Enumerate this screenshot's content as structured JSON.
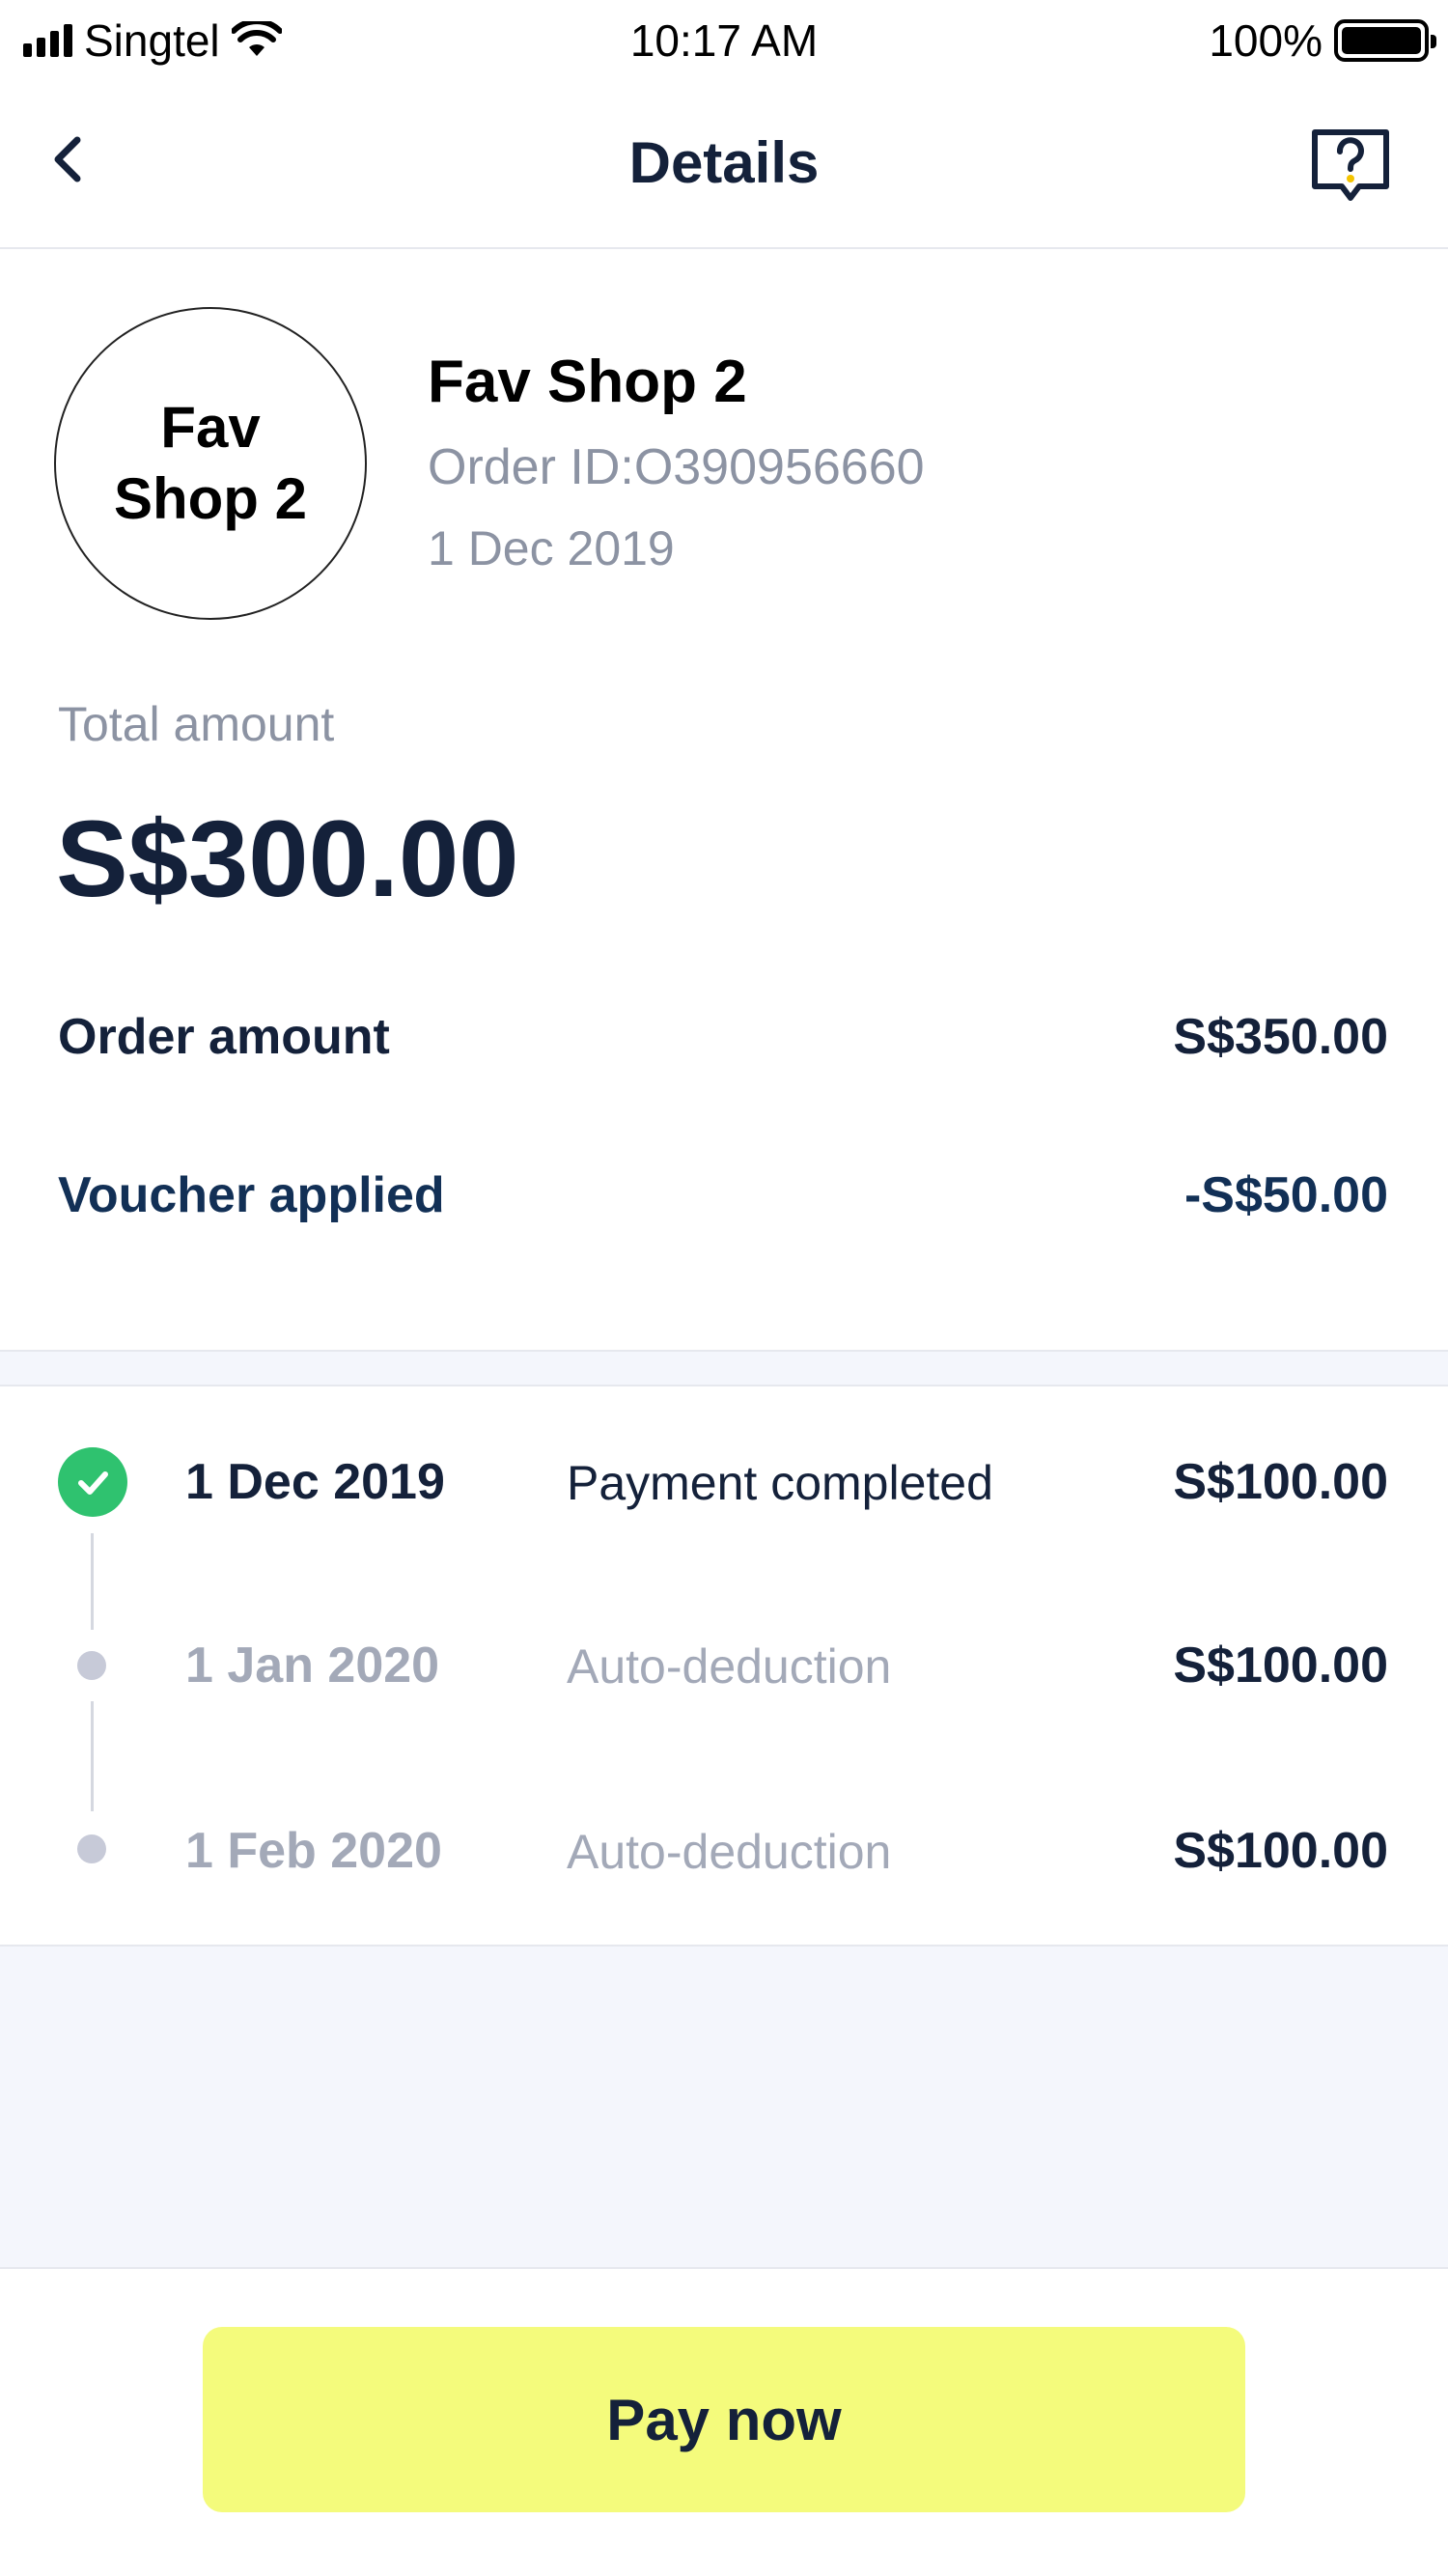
{
  "status_bar": {
    "carrier": "Singtel",
    "time": "10:17 AM",
    "battery": "100%"
  },
  "nav": {
    "title": "Details",
    "back_icon": "chevron-left-icon",
    "help_icon": "help-chat-icon"
  },
  "merchant": {
    "logo_text": "Fav Shop 2",
    "name": "Fav Shop 2",
    "order_id": "Order ID:O390956660",
    "date": "1 Dec 2019"
  },
  "summary": {
    "total_label": "Total amount",
    "total_amount": "S$300.00",
    "order_amount_label": "Order amount",
    "order_amount_value": "S$350.00",
    "voucher_label": "Voucher applied",
    "voucher_value": "-S$50.00"
  },
  "payments": [
    {
      "date": "1 Dec 2019",
      "description": "Payment completed",
      "amount": "S$100.00",
      "status": "completed"
    },
    {
      "date": "1 Jan 2020",
      "description": "Auto-deduction",
      "amount": "S$100.00",
      "status": "pending"
    },
    {
      "date": "1 Feb 2020",
      "description": "Auto-deduction",
      "amount": "S$100.00",
      "status": "pending"
    }
  ],
  "footer": {
    "pay_button_label": "Pay now"
  },
  "colors": {
    "primary_text": "#14213a",
    "muted_text": "#8c93a3",
    "success": "#2fc26f",
    "pay_button": "#f4fb7c",
    "band_bg": "#f4f6fc"
  }
}
